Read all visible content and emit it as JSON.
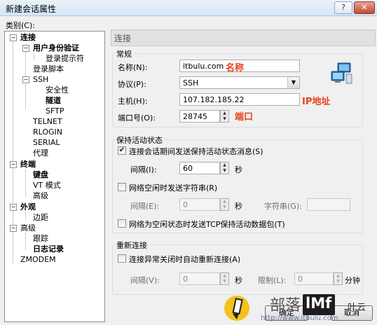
{
  "window": {
    "title": "新建会话属性",
    "help_glyph": "?",
    "close_glyph": "✕"
  },
  "category_label": "类别(C):",
  "tree": [
    {
      "label": "连接",
      "bold": true,
      "expander": "−"
    },
    {
      "label": "用户身份验证",
      "bold": true,
      "expander": "−"
    },
    {
      "label": "登录提示符",
      "bold": false
    },
    {
      "label": "登录脚本",
      "bold": false
    },
    {
      "label": "SSH",
      "bold": false,
      "expander": "−"
    },
    {
      "label": "安全性",
      "bold": false
    },
    {
      "label": "隧道",
      "bold": true
    },
    {
      "label": "SFTP",
      "bold": false
    },
    {
      "label": "TELNET",
      "bold": false
    },
    {
      "label": "RLOGIN",
      "bold": false
    },
    {
      "label": "SERIAL",
      "bold": false
    },
    {
      "label": "代理",
      "bold": false
    },
    {
      "label": "终端",
      "bold": true,
      "expander": "−"
    },
    {
      "label": "键盘",
      "bold": true
    },
    {
      "label": "VT 模式",
      "bold": false
    },
    {
      "label": "高级",
      "bold": false
    },
    {
      "label": "外观",
      "bold": true,
      "expander": "−"
    },
    {
      "label": "边距",
      "bold": false
    },
    {
      "label": "高级",
      "bold": false,
      "expander": "−"
    },
    {
      "label": "跟踪",
      "bold": false
    },
    {
      "label": "日志记录",
      "bold": true
    },
    {
      "label": "ZMODEM",
      "bold": false
    }
  ],
  "panel": {
    "header": "连接"
  },
  "general": {
    "title": "常规",
    "name_label": "名称(N):",
    "name_value": "itbulu.com",
    "protocol_label": "协议(P):",
    "protocol_value": "SSH",
    "host_label": "主机(H):",
    "host_value": "107.182.185.22",
    "port_label": "端口号(O):",
    "port_value": "28745"
  },
  "annotations": {
    "name": "名称",
    "host": "IP地址",
    "port": "端口"
  },
  "keepalive": {
    "title": "保持活动状态",
    "send_msg_label": "连接会话期间发送保持活动状态消息(S)",
    "send_msg_checked": true,
    "interval_label": "间隔(I):",
    "interval_value": "60",
    "unit_seconds": "秒",
    "send_str_label": "网络空闲时发送字符串(R)",
    "send_str_checked": false,
    "interval2_label": "间隔(E):",
    "interval2_value": "0",
    "unit_seconds2": "秒",
    "string_label": "字符串(G):",
    "string_value": "",
    "tcp_label": "网络为空闲状态时发送TCP保持活动数据包(T)",
    "tcp_checked": false
  },
  "reconnect": {
    "title": "重新连接",
    "auto_label": "连接异常关闭时自动重新连接(A)",
    "auto_checked": false,
    "interval_label": "间隔(V):",
    "interval_value": "0",
    "unit_seconds": "秒",
    "limit_label": "限制(L):",
    "limit_value": "0",
    "unit_minutes": "分钟"
  },
  "buttons": {
    "ok": "确定",
    "cancel": "取消"
  },
  "watermark": {
    "site_cn": "部落",
    "brand": "lMf",
    "extra": "叶云",
    "url": "http://www.itbulu.com"
  },
  "colors": {
    "annotation_red": "#e5441b",
    "titlebar": "#dbe8f6"
  }
}
